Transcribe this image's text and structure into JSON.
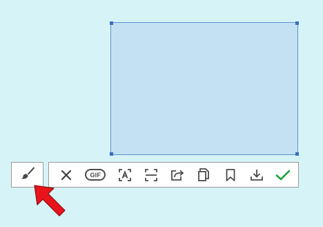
{
  "toolbar": {
    "gif_label": "GIF",
    "tools": [
      "close",
      "gif",
      "ocr",
      "scroll-capture",
      "share",
      "copy",
      "bookmark",
      "download",
      "confirm"
    ]
  },
  "icons": {
    "brush": "brush-icon",
    "close": "close-icon",
    "ocr": "text-recognition-icon",
    "scroll_capture": "scroll-capture-icon",
    "share": "share-icon",
    "copy": "copy-icon",
    "bookmark": "bookmark-icon",
    "download": "download-icon",
    "confirm": "checkmark-icon",
    "pointer": "red-arrow-pointer-icon"
  },
  "colors": {
    "background": "#d6f3f7",
    "selection_fill": "#c3e1f1",
    "selection_border": "#5b8fcf",
    "icon": "#4a4a4a",
    "confirm": "#1aa23c",
    "pointer": "#e8141b"
  }
}
